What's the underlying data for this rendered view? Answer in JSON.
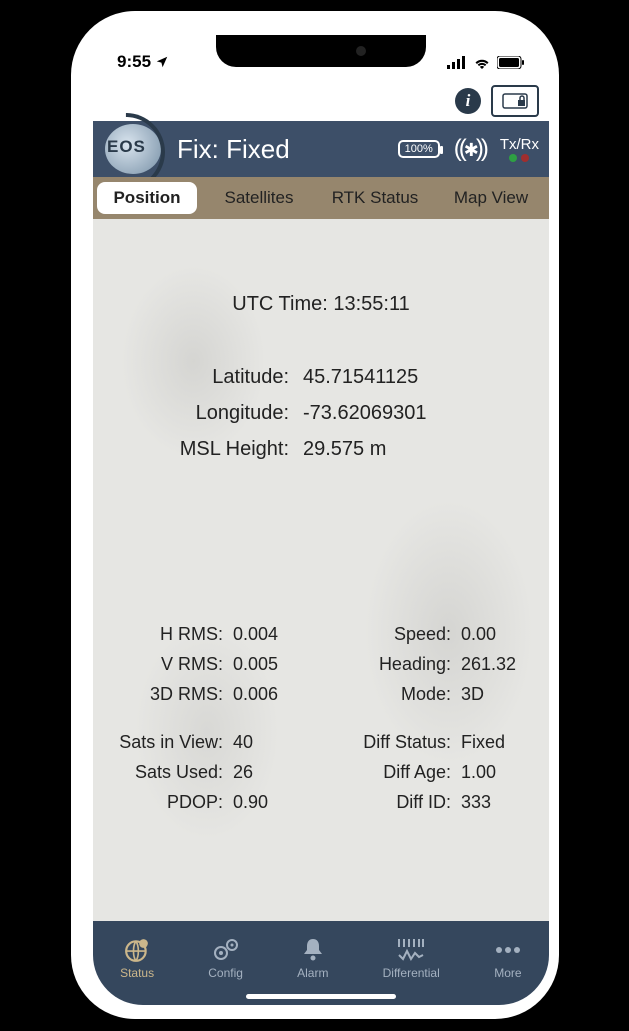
{
  "statusbar": {
    "time": "9:55"
  },
  "header": {
    "fix_label": "Fix: Fixed",
    "battery": "100%",
    "txrx_label": "Tx/Rx",
    "logo_text": "EOS"
  },
  "tabs": {
    "position": "Position",
    "satellites": "Satellites",
    "rtk": "RTK Status",
    "map": "Map View"
  },
  "position": {
    "utc_label": "UTC Time:",
    "utc_value": "13:55:11",
    "lat_label": "Latitude:",
    "lat_value": "45.71541125",
    "lon_label": "Longitude:",
    "lon_value": "-73.62069301",
    "msl_label": "MSL Height:",
    "msl_value": "29.575 m",
    "hrms_label": "H RMS:",
    "hrms_value": "0.004",
    "vrms_label": "V RMS:",
    "vrms_value": "0.005",
    "rms3d_label": "3D RMS:",
    "rms3d_value": "0.006",
    "siv_label": "Sats in View:",
    "siv_value": "40",
    "su_label": "Sats Used:",
    "su_value": "26",
    "pdop_label": "PDOP:",
    "pdop_value": "0.90",
    "speed_label": "Speed:",
    "speed_value": "0.00",
    "heading_label": "Heading:",
    "heading_value": "261.32",
    "mode_label": "Mode:",
    "mode_value": "3D",
    "ds_label": "Diff Status:",
    "ds_value": "Fixed",
    "da_label": "Diff Age:",
    "da_value": "1.00",
    "di_label": "Diff ID:",
    "di_value": "333"
  },
  "bottom": {
    "status": "Status",
    "config": "Config",
    "alarm": "Alarm",
    "differential": "Differential",
    "more": "More"
  }
}
